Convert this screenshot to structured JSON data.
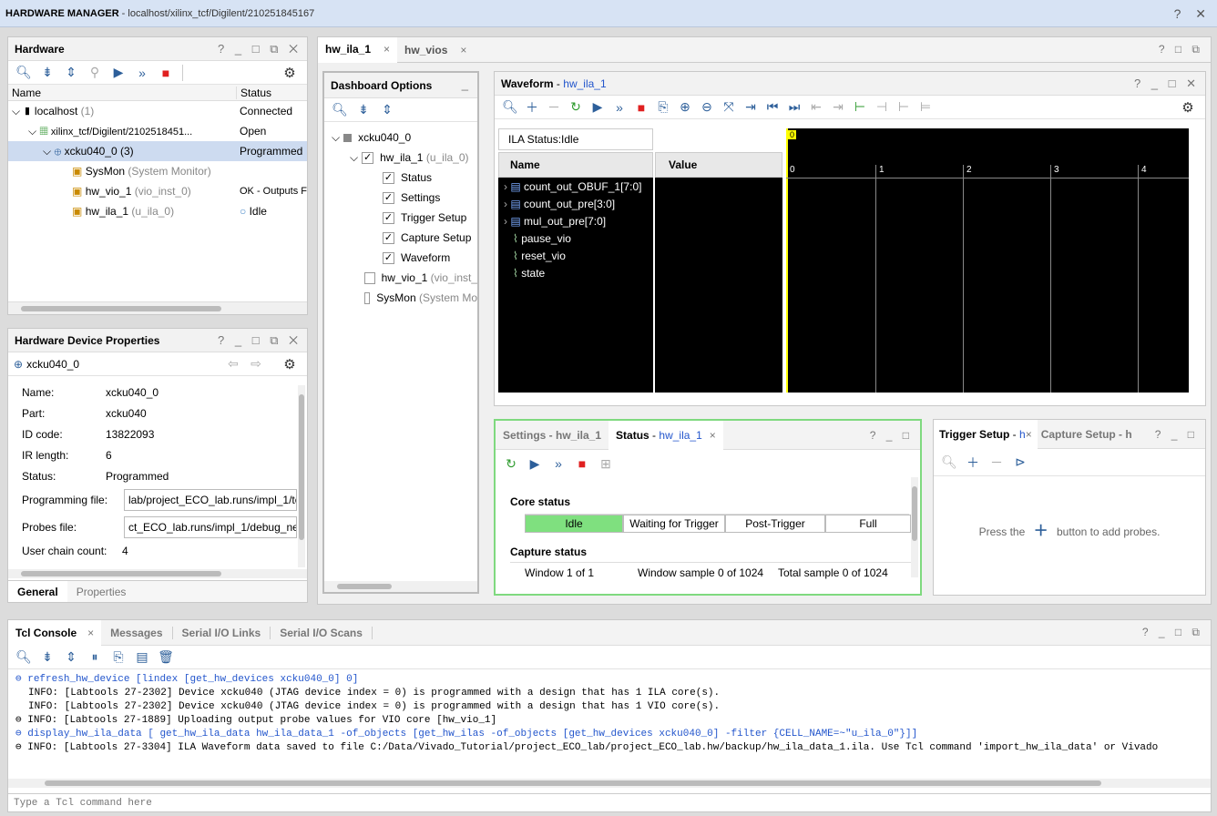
{
  "window": {
    "title_bold": "HARDWARE MANAGER",
    "title_path": "- localhost/xilinx_tcf/Digilent/210251845167",
    "controls": "? ✕"
  },
  "hardware": {
    "title": "Hardware",
    "controls": "? _ □ ⧉ ✕",
    "col_name": "Name",
    "col_status": "Status",
    "rows": [
      {
        "name": "localhost",
        "suffix": "(1)",
        "status": "Connected"
      },
      {
        "name": "xilinx_tcf/Digilent/2102518451...",
        "suffix": "",
        "status": "Open"
      },
      {
        "name": "xcku040_0",
        "suffix": "(3)",
        "status": "Programmed"
      },
      {
        "name": "SysMon",
        "suffix": "(System Monitor)",
        "status": ""
      },
      {
        "name": "hw_vio_1",
        "suffix": "(vio_inst_0)",
        "status": "OK - Outputs F"
      },
      {
        "name": "hw_ila_1",
        "suffix": "(u_ila_0)",
        "status": "Idle"
      }
    ]
  },
  "properties": {
    "title": "Hardware Device Properties",
    "controls": "? _ □ ⧉ ✕",
    "device": "xcku040_0",
    "fields": [
      {
        "label": "Name:",
        "value": "xcku040_0"
      },
      {
        "label": "Part:",
        "value": "xcku040"
      },
      {
        "label": "ID code:",
        "value": "13822093"
      },
      {
        "label": "IR length:",
        "value": "6"
      },
      {
        "label": "Status:",
        "value": "Programmed"
      },
      {
        "label": "Programming file:",
        "value": "lab/project_ECO_lab.runs/impl_1/tc"
      },
      {
        "label": "Probes file:",
        "value": "ct_ECO_lab.runs/impl_1/debug_ne"
      },
      {
        "label": "User chain count:",
        "value": "4"
      }
    ],
    "tabs": [
      "General",
      "Properties"
    ]
  },
  "main_tabs": {
    "tab1": "hw_ila_1",
    "tab2": "hw_vios",
    "controls": "? □ ⧉"
  },
  "dashboard": {
    "title": "Dashboard Options",
    "device": "xcku040_0",
    "ila": "hw_ila_1",
    "ila_suffix": "(u_ila_0)",
    "items": [
      "Status",
      "Settings",
      "Trigger Setup",
      "Capture Setup",
      "Waveform"
    ],
    "vio": "hw_vio_1",
    "vio_suffix": "(vio_inst_",
    "sysmon": "SysMon",
    "sysmon_suffix": "(System Mo"
  },
  "waveform": {
    "title": "Waveform",
    "title_link": "hw_ila_1",
    "controls": "? _ □ ✕",
    "ila_status": "ILA Status:Idle",
    "col_name": "Name",
    "col_value": "Value",
    "signals": [
      "count_out_OBUF_1[7:0]",
      "count_out_pre[3:0]",
      "mul_out_pre[7:0]",
      "pause_vio",
      "reset_vio",
      "state"
    ],
    "marker": "0",
    "ticks": [
      "0",
      "1",
      "2",
      "3",
      "4"
    ]
  },
  "status_panel": {
    "tab1": "Settings - hw_ila_1",
    "tab2": "Status",
    "tab2_link": "hw_ila_1",
    "controls": "? _ □",
    "core_status": "Core status",
    "states": [
      "Idle",
      "Waiting for Trigger",
      "Post-Trigger",
      "Full"
    ],
    "capture_status": "Capture status",
    "window": "Window 1 of 1",
    "window_sample": "Window sample 0 of 1024",
    "total_sample": "Total sample 0 of 1024"
  },
  "trigger_panel": {
    "tab1": "Trigger Setup",
    "tab1_link": "h",
    "tab2": "Capture Setup - h",
    "controls": "? _ □",
    "msg_before": "Press the",
    "msg_after": "button to add probes."
  },
  "console": {
    "tabs": [
      "Tcl Console",
      "Messages",
      "Serial I/O Links",
      "Serial I/O Scans"
    ],
    "controls": "? _ □ ⧉",
    "lines": [
      {
        "text": "refresh_hw_device [lindex [get_hw_devices xcku040_0] 0]",
        "cmd": true
      },
      {
        "text": "INFO: [Labtools 27-2302] Device xcku040 (JTAG device index = 0) is programmed with a design that has 1 ILA core(s).",
        "cmd": false
      },
      {
        "text": "INFO: [Labtools 27-2302] Device xcku040 (JTAG device index = 0) is programmed with a design that has 1 VIO core(s).",
        "cmd": false
      },
      {
        "text": "INFO: [Labtools 27-1889] Uploading output probe values for VIO core [hw_vio_1]",
        "cmd": false
      },
      {
        "text": "display_hw_ila_data [ get_hw_ila_data hw_ila_data_1 -of_objects [get_hw_ilas -of_objects [get_hw_devices xcku040_0] -filter {CELL_NAME=~\"u_ila_0\"}]]",
        "cmd": true
      },
      {
        "text": "INFO: [Labtools 27-3304] ILA Waveform data saved to file C:/Data/Vivado_Tutorial/project_ECO_lab/project_ECO_lab.hw/backup/hw_ila_data_1.ila. Use Tcl command 'import_hw_ila_data' or Vivado",
        "cmd": false
      }
    ],
    "placeholder": "Type a Tcl command here"
  }
}
